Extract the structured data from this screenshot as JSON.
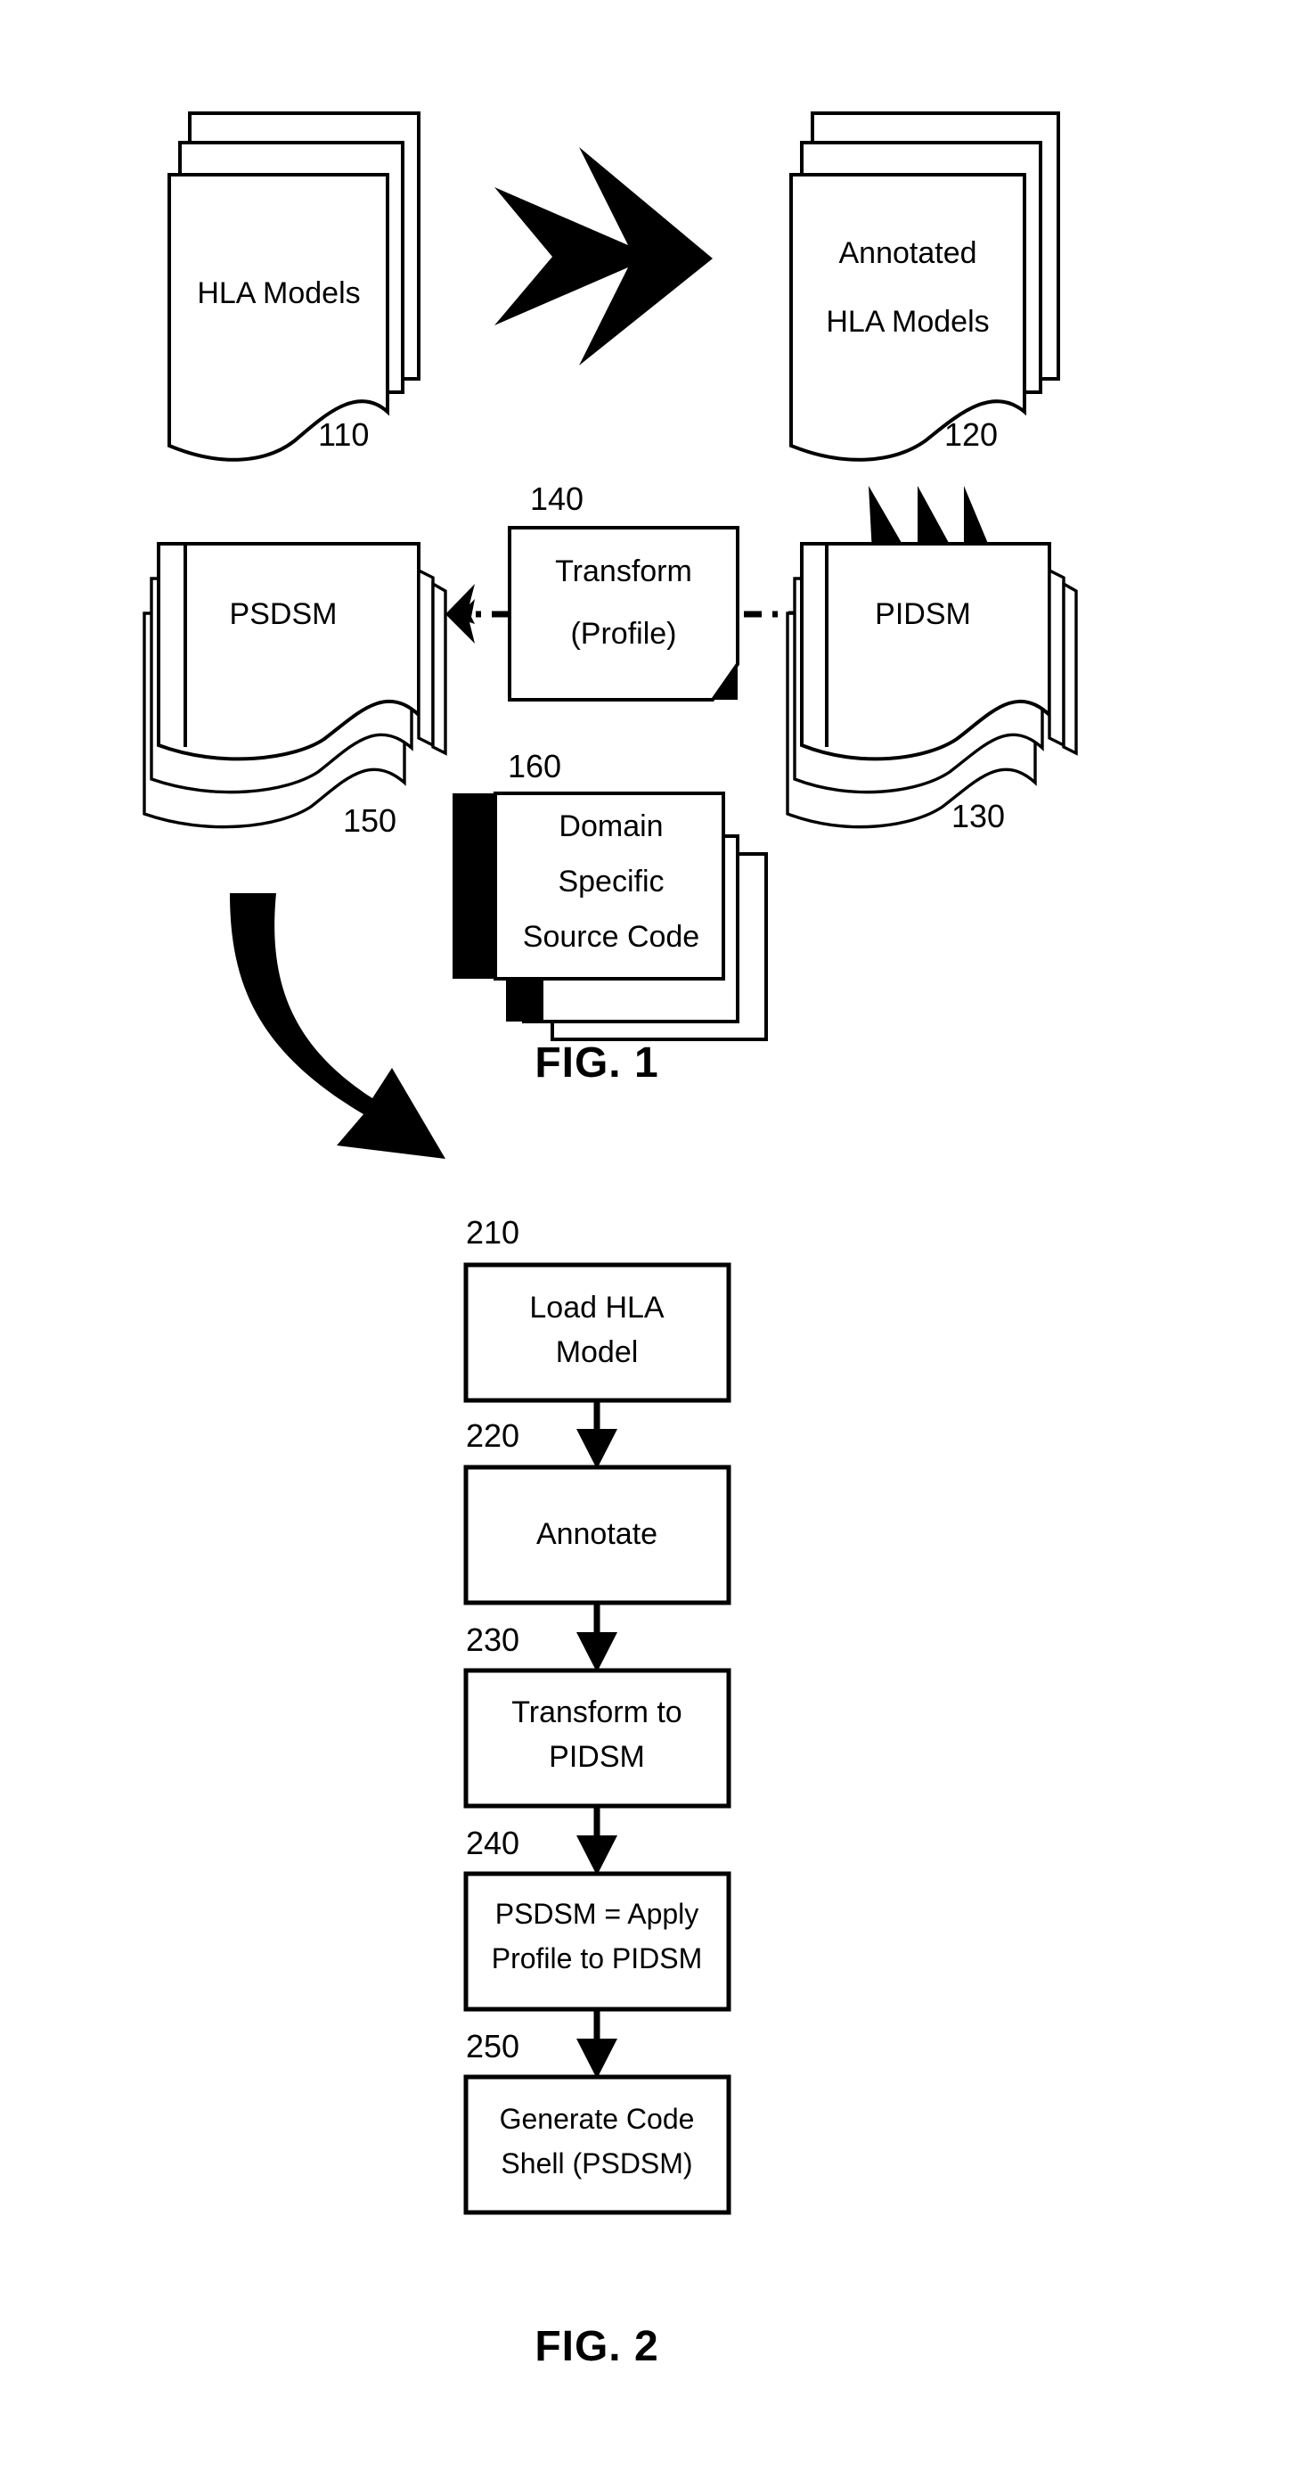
{
  "document": {
    "type": "patent-figure-sheet",
    "figures": [
      {
        "id": "fig1",
        "caption": "FIG. 1",
        "nodes": [
          {
            "key": "hla_models",
            "label_lines": [
              "HLA Models"
            ],
            "ref": "110",
            "shape": "document-stack"
          },
          {
            "key": "annotated_hla_models",
            "label_lines": [
              "Annotated",
              "HLA Models"
            ],
            "ref": "120",
            "shape": "document-stack"
          },
          {
            "key": "pidsm",
            "label_lines": [
              "PIDSM"
            ],
            "ref": "130",
            "shape": "document-stack-wavy"
          },
          {
            "key": "transform_profile",
            "label_lines": [
              "Transform",
              "(Profile)"
            ],
            "ref": "140",
            "shape": "folded-corner-box"
          },
          {
            "key": "psdsm",
            "label_lines": [
              "PSDSM"
            ],
            "ref": "150",
            "shape": "document-stack-wavy"
          },
          {
            "key": "domain_specific_source_code",
            "label_lines": [
              "Domain",
              "Specific",
              "Source Code"
            ],
            "ref": "160",
            "shape": "code-card-stack"
          }
        ],
        "connectors": [
          {
            "key": "hla-to-annotated",
            "style": "block-chevron-arrow",
            "direction": "right"
          },
          {
            "key": "annotated-to-pidsm",
            "style": "block-chevron-arrow",
            "direction": "down"
          },
          {
            "key": "pidsm-to-transform",
            "style": "dash-dot",
            "direction": "left"
          },
          {
            "key": "transform-to-psdsm",
            "style": "dash-dot-arrow",
            "direction": "left"
          },
          {
            "key": "psdsm-to-code",
            "style": "curved-block-arrow",
            "direction": "down-right"
          }
        ]
      },
      {
        "id": "fig2",
        "caption": "FIG. 2",
        "steps": [
          {
            "ref": "210",
            "label_lines": [
              "Load HLA",
              "Model"
            ]
          },
          {
            "ref": "220",
            "label_lines": [
              "Annotate"
            ]
          },
          {
            "ref": "230",
            "label_lines": [
              "Transform to",
              "PIDSM"
            ]
          },
          {
            "ref": "240",
            "label_lines": [
              "PSDSM = Apply",
              "Profile to PIDSM"
            ]
          },
          {
            "ref": "250",
            "label_lines": [
              "Generate Code",
              "Shell (PSDSM)"
            ]
          }
        ]
      }
    ]
  },
  "colors": {
    "ink": "#000000",
    "paper": "#ffffff"
  }
}
